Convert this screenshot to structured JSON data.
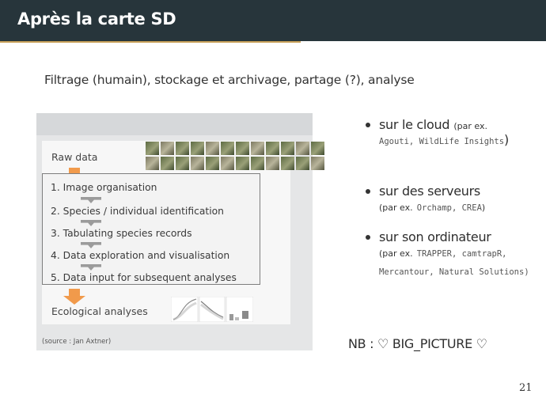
{
  "header": {
    "title": "Après la carte SD"
  },
  "subtitle": "Filtrage (humain), stockage et archivage, partage (?), analyse",
  "figure": {
    "raw_label": "Raw data",
    "steps": [
      "1. Image organisation",
      "2. Species / individual identification",
      "3. Tabulating species records",
      "4. Data exploration and visualisation",
      "5. Data input for subsequent analyses"
    ],
    "eco_label": "Ecological analyses",
    "source": "(source : Jan Axtner)"
  },
  "bullets": [
    {
      "main": "sur le cloud",
      "note_open": "(par ex.",
      "tools": "Agouti, WildLife Insights",
      "close": ")"
    },
    {
      "main": "sur des serveurs",
      "note_open": "(par ex.",
      "tools": "Orchamp, CREA",
      "close": ")"
    },
    {
      "main": "sur son ordinateur",
      "note_open": "(par ex.",
      "tools": "TRAPPER, camtrapR, Mercantour, Natural Solutions",
      "close": ")"
    }
  ],
  "nb": "NB : ♡ BIG_PICTURE ♡",
  "page_number": "21",
  "colors": {
    "header_bg": "#27353b",
    "accent": "#c9a15a",
    "arrow_orange": "#f19a4b"
  }
}
